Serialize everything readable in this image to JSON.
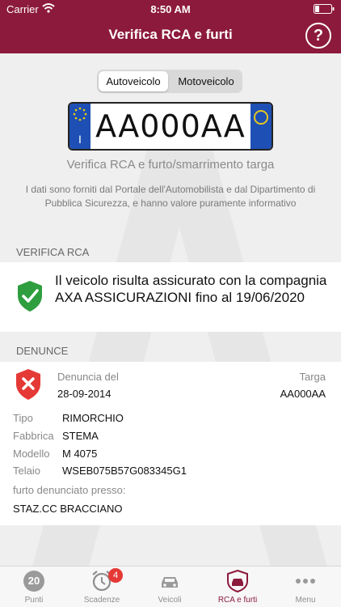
{
  "status_bar": {
    "carrier": "Carrier",
    "time": "8:50 AM"
  },
  "nav": {
    "title": "Verifica RCA e furti",
    "help_label": "?"
  },
  "segmented": {
    "auto_label": "Autoveicolo",
    "moto_label": "Motoveicolo",
    "selected": "Autoveicolo"
  },
  "plate": {
    "text": "AA000AA",
    "country_letter": "I"
  },
  "subtitle": "Verifica RCA e furto/smarrimento targa",
  "disclaimer": "I dati sono forniti dal Portale dell'Automobilista e dal Dipartimento di Pubblica Sicurezza, e hanno valore puramente informativo",
  "rca": {
    "header": "VERIFICA RCA",
    "message": "Il veicolo risulta assicurato con la compagnia AXA ASSICURAZIONI fino al 19/06/2020"
  },
  "denunce": {
    "header": "DENUNCE",
    "date_label": "Denuncia del",
    "date_value": "28-09-2014",
    "plate_label": "Targa",
    "plate_value": "AA000AA",
    "tipo_label": "Tipo",
    "tipo_value": "RIMORCHIO",
    "fabbrica_label": "Fabbrica",
    "fabbrica_value": "STEMA",
    "modello_label": "Modello",
    "modello_value": "M 4075",
    "telaio_label": "Telaio",
    "telaio_value": "WSEB075B57G083345G1",
    "furto_label": "furto denunciato presso:",
    "furto_value": "STAZ.CC BRACCIANO"
  },
  "tabs": [
    {
      "label": "Punti",
      "icon": "points-icon",
      "value": "20"
    },
    {
      "label": "Scadenze",
      "icon": "alarm-clock-icon",
      "badge": "4"
    },
    {
      "label": "Veicoli",
      "icon": "car-icon"
    },
    {
      "label": "RCA e furti",
      "icon": "car-shield-icon",
      "active": true
    },
    {
      "label": "Menu",
      "icon": "more-dots-icon"
    }
  ],
  "colors": {
    "brand": "#8c1a3c",
    "ok_green": "#2e9e3e",
    "alert_red": "#e53935",
    "plate_blue": "#1e4fb4"
  }
}
